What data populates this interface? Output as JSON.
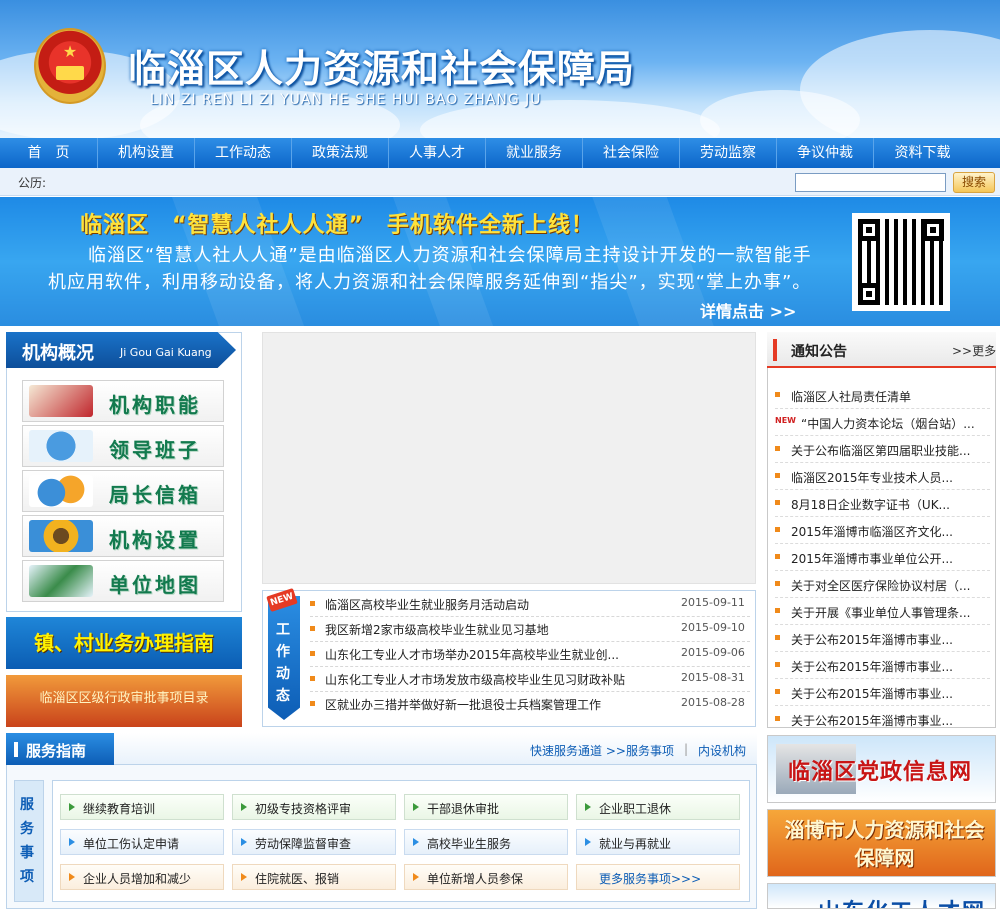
{
  "header": {
    "title": "临淄区人力资源和社会保障局",
    "pinyin": "LIN ZI REN LI ZI YUAN HE SHE HUI BAO ZHANG JU"
  },
  "nav": {
    "items": [
      "首　页",
      "机构设置",
      "工作动态",
      "政策法规",
      "人事人才",
      "就业服务",
      "社会保险",
      "劳动监察",
      "争议仲裁",
      "资料下载"
    ]
  },
  "bulletin": {
    "label": "公历:",
    "search_placeholder": "",
    "search_button": "搜索"
  },
  "banner": {
    "headline": "临淄区　“智慧人社人人通”　手机软件全新上线！",
    "body": "临淄区“智慧人社人人通”是由临淄区人力资源和社会保障局主持设计开发的一款智能手机应用软件，利用移动设备，将人力资源和社会保障服务延伸到“指尖”，实现“掌上办事”。",
    "more": "详情点击 >>"
  },
  "left": {
    "title": "机构概况",
    "title_pinyin": "Ji Gou Gai Kuang",
    "items": [
      {
        "label": "机构职能",
        "color": "#c0262c"
      },
      {
        "label": "领导班子",
        "color": "#4a9be0"
      },
      {
        "label": "局长信箱",
        "color": "#f5a52a"
      },
      {
        "label": "机构设置",
        "color": "#f2b21f"
      },
      {
        "label": "单位地图",
        "color": "#3a8c4a"
      }
    ],
    "guide_banner": "镇、村业务办理指南",
    "guide_banner_2": "临淄区区级行政审批事项目录"
  },
  "news": {
    "new_badge": "NEW",
    "tab_chars": [
      "工",
      "作",
      "动",
      "态"
    ],
    "items": [
      {
        "title": "临淄区高校毕业生就业服务月活动启动",
        "date": "2015-09-11"
      },
      {
        "title": "我区新增2家市级高校毕业生就业见习基地",
        "date": "2015-09-10"
      },
      {
        "title": "山东化工专业人才市场举办2015年高校毕业生就业创...",
        "date": "2015-09-06"
      },
      {
        "title": "山东化工专业人才市场发放市级高校毕业生见习财政补贴",
        "date": "2015-08-31"
      },
      {
        "title": "区就业办三措并举做好新一批退役士兵档案管理工作",
        "date": "2015-08-28"
      }
    ]
  },
  "notice": {
    "title": "通知公告",
    "more": ">>更多",
    "new_label": "NEW",
    "items": [
      {
        "title": "临淄区人社局责任清单",
        "is_new": false
      },
      {
        "title": "“中国人力资本论坛（烟台站）...",
        "is_new": true
      },
      {
        "title": "关于公布临淄区第四届职业技能...",
        "is_new": false
      },
      {
        "title": "临淄区2015年专业技术人员...",
        "is_new": false
      },
      {
        "title": "8月18日企业数字证书（UK...",
        "is_new": false
      },
      {
        "title": "2015年淄博市临淄区齐文化...",
        "is_new": false
      },
      {
        "title": "2015年淄博市事业单位公开...",
        "is_new": false
      },
      {
        "title": "关于对全区医疗保险协议村居（...",
        "is_new": false
      },
      {
        "title": "关于开展《事业单位人事管理条...",
        "is_new": false
      },
      {
        "title": "关于公布2015年淄博市事业...",
        "is_new": false
      },
      {
        "title": "关于公布2015年淄博市事业...",
        "is_new": false
      },
      {
        "title": "关于公布2015年淄博市事业...",
        "is_new": false
      },
      {
        "title": "关于公布2015年淄博市事业...",
        "is_new": false
      }
    ]
  },
  "links": {
    "party": "临淄区党政信息网",
    "zibo": "淄博市人力资源和社会保障网",
    "shandong": "山东化工人才网"
  },
  "service": {
    "title": "服务指南",
    "nav": [
      "快速服务通道 >>",
      "服务事项",
      "|",
      "内设机构"
    ],
    "side_chars": [
      "服",
      "务",
      "事",
      "项"
    ],
    "items": [
      "继续教育培训",
      "初级专技资格评审",
      "干部退休审批",
      "企业职工退休",
      "单位工伤认定申请",
      "劳动保障监督审查",
      "高校毕业生服务",
      "就业与再就业",
      "企业人员增加和减少",
      "住院就医、报销",
      "单位新增人员参保",
      "更多服务事项>>>"
    ]
  }
}
